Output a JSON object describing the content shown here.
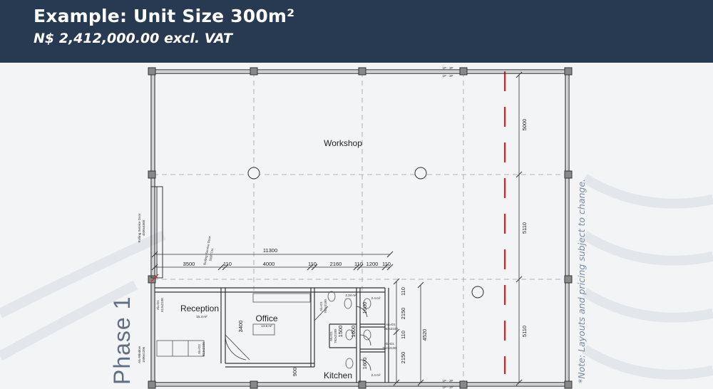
{
  "header": {
    "title": "Example: Unit Size 300m²",
    "price": "N$ 2,412,000.00 excl. VAT"
  },
  "plan": {
    "phase_label": "Phase 1",
    "note": "*Note: Layouts and pricing subject to change.",
    "rooms": {
      "workshop": "Workshop",
      "reception": "Reception",
      "reception_area": "15.4 m²",
      "office": "Office",
      "office_area": "13.6 m²",
      "kitchen": "Kitchen",
      "wc1_area": "2.34 m²",
      "wc2_area": "2.4 m²",
      "wc3_area": "2.4 m²"
    },
    "dimensions": {
      "overall_width": "11300",
      "segments": [
        "3500",
        "110",
        "4000",
        "110",
        "2160",
        "110",
        "1200",
        "110"
      ],
      "right_upper": "5000",
      "right_middle": "5110",
      "right_lower": "5110",
      "reception_height": "3400",
      "wc_a": "1600",
      "wc_b": "1500",
      "wc_c": "1600",
      "wc_d": "1600",
      "stack_110_top": "110",
      "stack_2150_top": "2150",
      "stack_110_mid": "110",
      "stack_2150_bottom": "2150",
      "stack_4520": "4520",
      "door_900": "900"
    },
    "labels": {
      "rolling_door": "Rolling Service Door",
      "rolling_door_size": "4500x4500",
      "rolling_door_switch": "Rolling Service Door",
      "switch": "SWITCH",
      "window_top": "1P - 3P",
      "window_top_b": "1P - 3P",
      "window_bottom": "1P - 3P",
      "window_bottom_b": "1P - 3P",
      "alu_d1": "Alu-D1",
      "alu_d1_size": "813x2100",
      "alu_d2": "Alu-D2",
      "alu_d2_size": "813x2100",
      "alu_d1_b": "Alu-D1",
      "alu_d1_b_size": "762x2100",
      "alu_d1_c": "Alu-D1",
      "alu_d1_c_size": "762x2100",
      "alu_d1_d": "Alu-D1",
      "alu_d1_d_size": "762x2100",
      "alu_d1_e": "Alu-D1",
      "alu_d1_e_size": "762x2100",
      "alu_window": "Alu-Window",
      "alu_window_size": "1500x1200"
    }
  }
}
